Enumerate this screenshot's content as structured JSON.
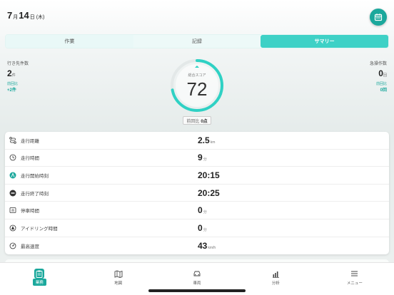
{
  "header": {
    "month": "7",
    "month_unit": "月",
    "day": "14",
    "day_unit": "日",
    "weekday": "(木)",
    "calendar_icon": "calendar-icon"
  },
  "tabs": [
    {
      "label": "作業"
    },
    {
      "label": "記録"
    },
    {
      "label": "サマリー"
    }
  ],
  "summary": {
    "left": {
      "title": "行き先件数",
      "value": "2",
      "unit": "件",
      "compare_label": "前回比",
      "compare_value": "+2件"
    },
    "right": {
      "title": "急操作数",
      "value": "0",
      "unit": "回",
      "compare_label": "前回比",
      "compare_value": "0回"
    },
    "score": {
      "label": "総合スコア",
      "value": "72",
      "fraction": 0.72,
      "prev_label": "前回比",
      "prev_value": "0点"
    }
  },
  "metrics": [
    {
      "label": "走行距離",
      "value": "2.5",
      "unit": "km",
      "icon": "route-icon"
    },
    {
      "label": "走行時間",
      "value": "9",
      "unit": "分",
      "icon": "clock-icon"
    },
    {
      "label": "走行開始時刻",
      "value": "20:15",
      "unit": "",
      "icon": "start-icon"
    },
    {
      "label": "走行終了時刻",
      "value": "20:25",
      "unit": "",
      "icon": "end-icon"
    },
    {
      "label": "停車時間",
      "value": "0",
      "unit": "分",
      "icon": "parking-icon"
    },
    {
      "label": "アイドリング時間",
      "value": "0",
      "unit": "分",
      "icon": "idling-icon"
    },
    {
      "label": "最高速度",
      "value": "43",
      "unit": "km/h",
      "icon": "speed-icon"
    }
  ],
  "nav": [
    {
      "label": "業務",
      "icon": "clipboard-icon",
      "active": true
    },
    {
      "label": "地図",
      "icon": "map-icon",
      "active": false
    },
    {
      "label": "車両",
      "icon": "car-icon",
      "active": false
    },
    {
      "label": "分析",
      "icon": "chart-icon",
      "active": false
    },
    {
      "label": "メニュー",
      "icon": "menu-icon",
      "active": false
    }
  ],
  "colors": {
    "accent": "#1ba89c",
    "tab_active": "#3ed1c6",
    "gauge": "#2fd1c4"
  }
}
